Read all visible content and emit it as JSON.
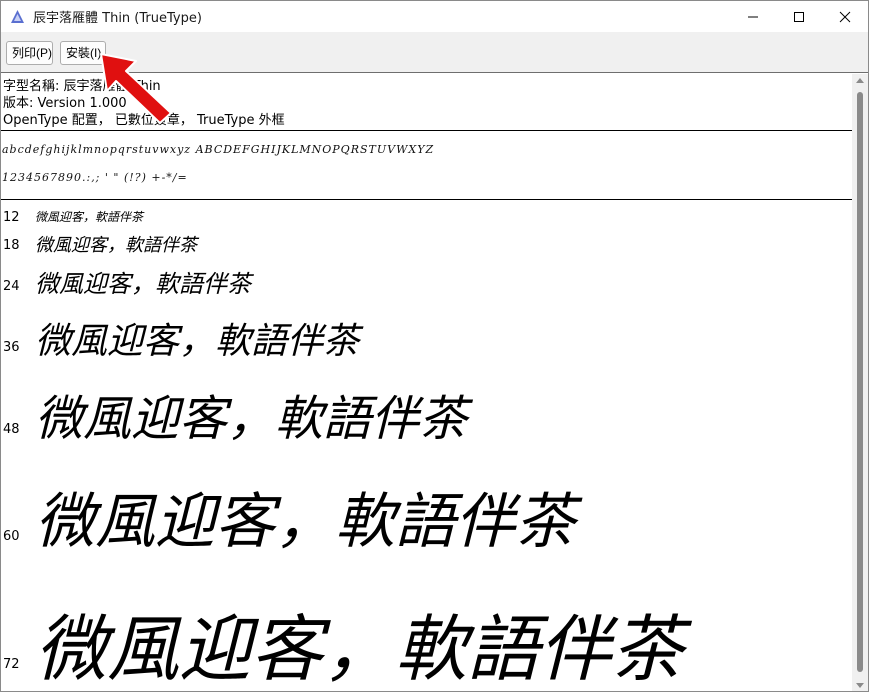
{
  "window": {
    "title": "辰宇落雁體 Thin (TrueType)",
    "icon": "font-viewer-icon"
  },
  "toolbar": {
    "print_label": "列印(P)",
    "install_label": "安裝(I)"
  },
  "meta": {
    "font_name": "字型名稱: 辰宇落雁體 Thin",
    "version": "版本: Version 1.000",
    "features": "OpenType 配置， 已數位簽章， TrueType 外框"
  },
  "charset": {
    "alphabet": "abcdefghijklmnopqrstuvwxyz ABCDEFGHIJKLMNOPQRSTUVWXYZ",
    "digits": "1234567890.:,; ' \" (!?) +-*/="
  },
  "samples": [
    {
      "size": "12",
      "text": "微風迎客，軟語伴茶"
    },
    {
      "size": "18",
      "text": "微風迎客，軟語伴茶"
    },
    {
      "size": "24",
      "text": "微風迎客，軟語伴茶"
    },
    {
      "size": "36",
      "text": "微風迎客，軟語伴茶"
    },
    {
      "size": "48",
      "text": "微風迎客，軟語伴茶"
    },
    {
      "size": "60",
      "text": "微風迎客，軟語伴茶"
    },
    {
      "size": "72",
      "text": "微風迎客，軟語伴茶"
    }
  ],
  "colors": {
    "annotation_arrow": "#e01010",
    "toolbar_bg": "#f0f0f0"
  }
}
